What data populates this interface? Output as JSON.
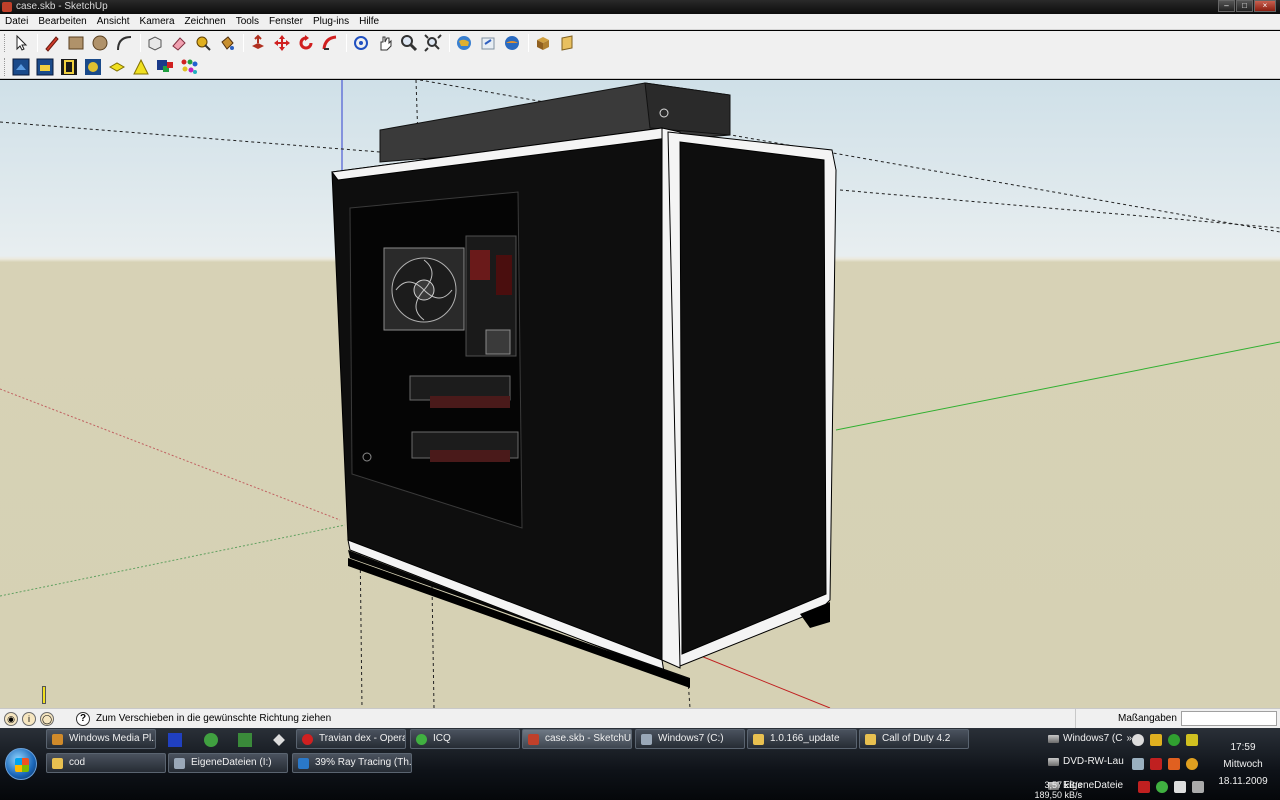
{
  "window": {
    "title": "case.skb - SketchUp"
  },
  "menu": [
    "Datei",
    "Bearbeiten",
    "Ansicht",
    "Kamera",
    "Zeichnen",
    "Tools",
    "Fenster",
    "Plug-ins",
    "Hilfe"
  ],
  "toolbar_row1": [
    "select-arrow-icon",
    "pencil-line-icon",
    "rectangle-icon",
    "circle-icon",
    "arc-icon",
    "make-component-icon",
    "eraser-icon",
    "tape-measure-icon",
    "paint-bucket-icon",
    "push-pull-icon",
    "move-icon",
    "rotate-icon",
    "follow-me-icon",
    "orbit-icon",
    "pan-icon",
    "zoom-icon",
    "zoom-extents-icon",
    "get-models-icon",
    "share-model-icon",
    "google-earth-icon",
    "components-icon",
    "section-plane-icon"
  ],
  "toolbar_row2": [
    "xray-style-icon",
    "wireframe-style-icon",
    "hidden-line-icon",
    "shaded-style-icon",
    "layer-yellow-icon",
    "triangle-yellow-icon",
    "colors-icon",
    "materials-dots-icon"
  ],
  "statusbar": {
    "hint": "Zum Verschieben in die gewünschte Richtung ziehen",
    "measure_label": "Maßangaben",
    "measure_value": ""
  },
  "taskbar": {
    "row1": [
      {
        "label": "Windows Media Pl...",
        "color": "#d08a2a"
      },
      {
        "label": "Travian dex - Opera",
        "color": "#d02020"
      },
      {
        "label": "ICQ",
        "color": "#40b040"
      },
      {
        "label": "case.skb - SketchUp",
        "color": "#c0402a",
        "active": true
      },
      {
        "label": "Windows7 (C:)",
        "color": "#9aa8b8"
      },
      {
        "label": "1.0.166_update",
        "color": "#e8c050"
      },
      {
        "label": "Call of Duty 4.2",
        "color": "#e8c050"
      }
    ],
    "row2": [
      {
        "label": "cod",
        "color": "#e8c050"
      },
      {
        "label": "EigeneDateien (I:)",
        "color": "#9aa8b8"
      },
      {
        "label": "39% Ray Tracing (Th...",
        "color": "#2a78c8"
      }
    ]
  },
  "tray": {
    "drive1": "Windows7 (C",
    "drive2": "DVD-RW-Lau",
    "drive3": "EigeneDateie",
    "more": "»",
    "net_up": "3,57 kB/s",
    "net_down": "189,50 kB/s",
    "time": "17:59",
    "day": "Mittwoch",
    "date": "18.11.2009"
  }
}
